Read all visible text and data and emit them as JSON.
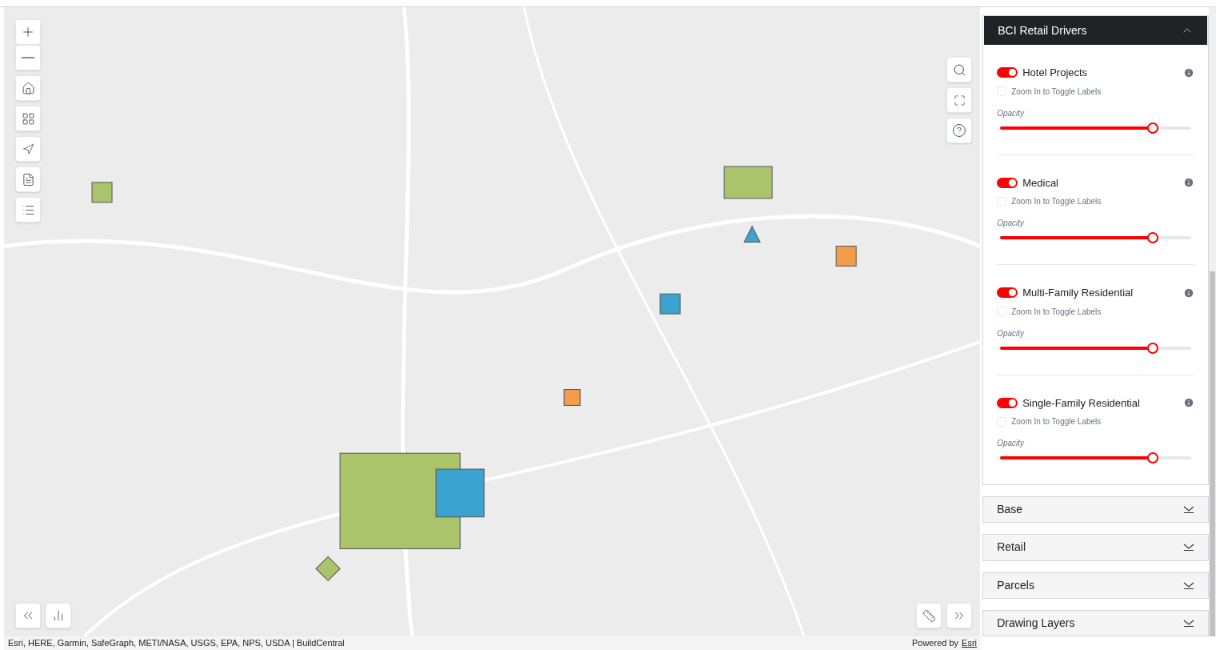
{
  "panel": {
    "title": "BCI Retail Drivers",
    "expanded": true,
    "layers": [
      {
        "name": "Hotel Projects",
        "on": true,
        "labels_checked": false,
        "labels_text": "Zoom In to Toggle Labels",
        "opacity_label": "Opacity",
        "level": 0.8
      },
      {
        "name": "Medical",
        "on": true,
        "labels_checked": false,
        "labels_text": "Zoom In to Toggle Labels",
        "opacity_label": "Opacity",
        "level": 0.8
      },
      {
        "name": "Multi-Family Residential",
        "on": true,
        "labels_checked": false,
        "labels_text": "Zoom In to Toggle Labels",
        "opacity_label": "Opacity",
        "level": 0.8
      },
      {
        "name": "Single-Family Residential",
        "on": true,
        "labels_checked": false,
        "labels_text": "Zoom In to Toggle Labels",
        "opacity_label": "Opacity",
        "level": 0.8
      }
    ]
  },
  "sections": [
    {
      "title": "Base",
      "expanded": false
    },
    {
      "title": "Retail",
      "expanded": false
    },
    {
      "title": "Parcels",
      "expanded": false
    },
    {
      "title": "Drawing Layers",
      "expanded": false
    }
  ],
  "attribution": {
    "sources": "Esri, HERE, Garmin, SafeGraph, METI/NASA, USGS, EPA, NPS, USDA | BuildCentral",
    "powered_by": "Powered by",
    "link": "Esri"
  }
}
